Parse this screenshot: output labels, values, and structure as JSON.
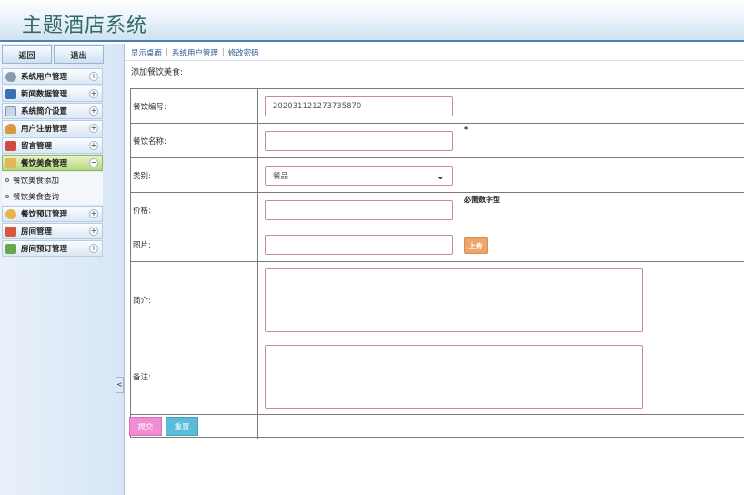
{
  "app": {
    "title": "主题酒店系统"
  },
  "sidebar": {
    "back_label": "返回",
    "logout_label": "退出",
    "collapse_glyph": "<",
    "items": [
      {
        "label": "系统用户管理",
        "icon": "gear-icon",
        "color": "#8a9bb0",
        "exp": "+"
      },
      {
        "label": "新闻数据管理",
        "icon": "monitor-icon",
        "color": "#3d6fb6",
        "exp": "+"
      },
      {
        "label": "系统简介设置",
        "icon": "calendar-icon",
        "color": "#c9d6e5",
        "exp": "+"
      },
      {
        "label": "用户注册管理",
        "icon": "user-icon",
        "color": "#d79a43",
        "exp": "+"
      },
      {
        "label": "留言管理",
        "icon": "message-icon",
        "color": "#d04a3f",
        "exp": "+"
      },
      {
        "label": "餐饮美食管理",
        "icon": "folder-icon",
        "color": "#e0b85b",
        "exp": "−"
      },
      {
        "label": "餐饮预订管理",
        "icon": "coins-icon",
        "color": "#e9b44a",
        "exp": "+"
      },
      {
        "label": "房间管理",
        "icon": "chart-icon",
        "color": "#d6593d",
        "exp": "+"
      },
      {
        "label": "房间预订管理",
        "icon": "grid-icon",
        "color": "#6aa84f",
        "exp": "+"
      }
    ],
    "subitems": [
      "餐饮美食添加",
      "餐饮美食查询"
    ]
  },
  "nav": {
    "items": [
      "显示桌面",
      "系统用户管理",
      "修改密码"
    ]
  },
  "page": {
    "title": "添加餐饮美食:"
  },
  "form": {
    "id_label": "餐饮编号:",
    "id_value": "202031121273735870",
    "name_label": "餐饮名称:",
    "name_value": "",
    "required_mark": "*",
    "category_label": "类别:",
    "category_value": "餐品",
    "price_label": "价格:",
    "price_value": "",
    "price_hint": "必需数字型",
    "image_label": "图片:",
    "image_value": "",
    "upload_label": "上传",
    "intro_label": "简介:",
    "note_label": "备注:",
    "submit_label": "提交",
    "reset_label": "重置"
  }
}
